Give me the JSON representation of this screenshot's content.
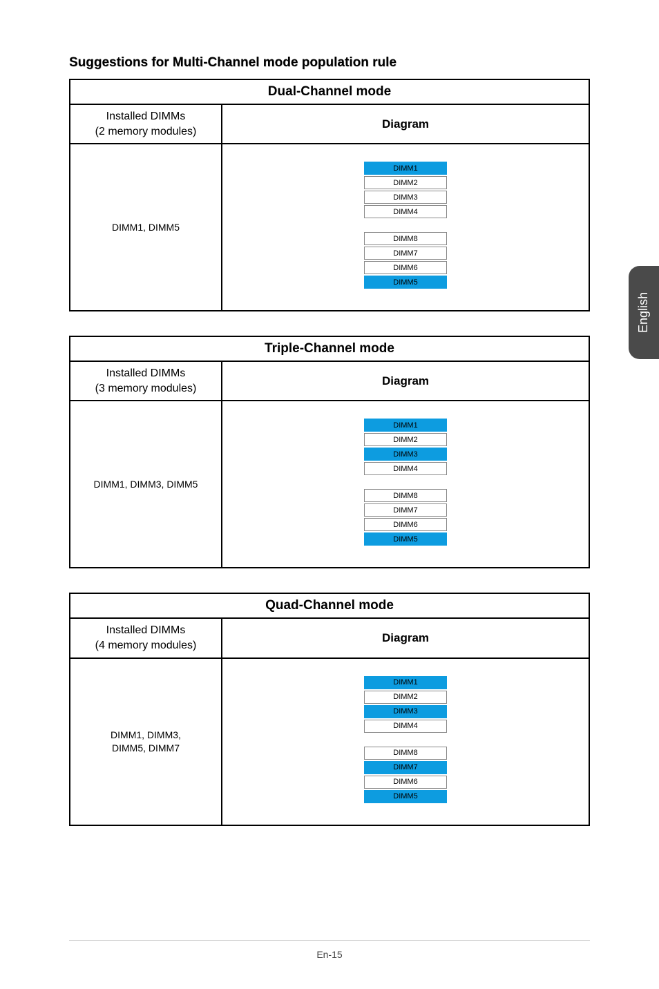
{
  "section_title": "Suggestions for Multi-Channel mode population rule",
  "side_tab": "English",
  "page_number": "En-15",
  "tables": [
    {
      "mode_title": "Dual-Channel mode",
      "header_left_line1": "Installed DIMMs",
      "header_left_line2": "(2 memory modules)",
      "header_right": "Diagram",
      "installed": "DIMM1, DIMM5",
      "chart_data": {
        "type": "table",
        "slots": [
          {
            "label": "DIMM1",
            "populated": true
          },
          {
            "label": "DIMM2",
            "populated": false
          },
          {
            "label": "DIMM3",
            "populated": false
          },
          {
            "label": "DIMM4",
            "populated": false
          },
          {
            "label": "DIMM8",
            "populated": false
          },
          {
            "label": "DIMM7",
            "populated": false
          },
          {
            "label": "DIMM6",
            "populated": false
          },
          {
            "label": "DIMM5",
            "populated": true
          }
        ]
      }
    },
    {
      "mode_title": "Triple-Channel mode",
      "header_left_line1": "Installed DIMMs",
      "header_left_line2": "(3 memory modules)",
      "header_right": "Diagram",
      "installed": "DIMM1, DIMM3, DIMM5",
      "chart_data": {
        "type": "table",
        "slots": [
          {
            "label": "DIMM1",
            "populated": true
          },
          {
            "label": "DIMM2",
            "populated": false
          },
          {
            "label": "DIMM3",
            "populated": true
          },
          {
            "label": "DIMM4",
            "populated": false
          },
          {
            "label": "DIMM8",
            "populated": false
          },
          {
            "label": "DIMM7",
            "populated": false
          },
          {
            "label": "DIMM6",
            "populated": false
          },
          {
            "label": "DIMM5",
            "populated": true
          }
        ]
      }
    },
    {
      "mode_title": "Quad-Channel mode",
      "header_left_line1": "Installed DIMMs",
      "header_left_line2": "(4 memory modules)",
      "header_right": "Diagram",
      "installed_line1": "DIMM1, DIMM3,",
      "installed_line2": "DIMM5, DIMM7",
      "chart_data": {
        "type": "table",
        "slots": [
          {
            "label": "DIMM1",
            "populated": true
          },
          {
            "label": "DIMM2",
            "populated": false
          },
          {
            "label": "DIMM3",
            "populated": true
          },
          {
            "label": "DIMM4",
            "populated": false
          },
          {
            "label": "DIMM8",
            "populated": false
          },
          {
            "label": "DIMM7",
            "populated": true
          },
          {
            "label": "DIMM6",
            "populated": false
          },
          {
            "label": "DIMM5",
            "populated": true
          }
        ]
      }
    }
  ]
}
